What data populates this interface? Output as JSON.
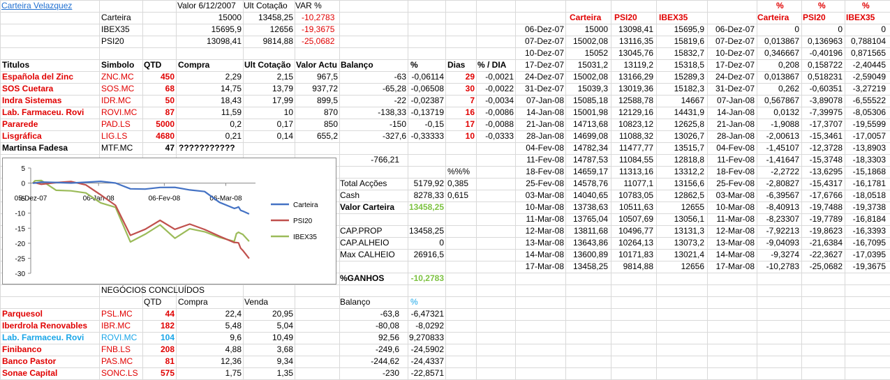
{
  "left": {
    "title": "Carteira Velazquez",
    "hdr": {
      "valor": "Valor 6/12/2007",
      "ult": "Ult Cotação",
      "var": "VAR %"
    },
    "summary": [
      {
        "name": "Carteira",
        "valor": "15000",
        "ult": "13458,25",
        "var": "-10,2783"
      },
      {
        "name": "IBEX35",
        "valor": "15695,9",
        "ult": "12656",
        "var": "-19,3675"
      },
      {
        "name": "PSI20",
        "valor": "13098,41",
        "ult": "9814,88",
        "var": "-25,0682"
      }
    ],
    "cols": {
      "titulos": "Titulos",
      "simbolo": "Simbolo",
      "qtd": "QTD",
      "compra": "Compra",
      "ult": "Ult Cotação",
      "valor": "Valor Actu",
      "balanco": "Balanço",
      "pct": "%",
      "dias": "Dias",
      "pdia": "% / DIA"
    },
    "holdings": [
      {
        "name": "Española del Zinc",
        "sym": "ZNC.MC",
        "qtd": "450",
        "compra": "2,29",
        "ult": "2,15",
        "valor": "967,5",
        "bal": "-63",
        "pct": "-0,06114",
        "dias": "29",
        "pdia": "-0,0021"
      },
      {
        "name": "SOS Cuetara",
        "sym": "SOS.MC",
        "qtd": "68",
        "compra": "14,75",
        "ult": "13,79",
        "valor": "937,72",
        "bal": "-65,28",
        "pct": "-0,06508",
        "dias": "30",
        "pdia": "-0,0022"
      },
      {
        "name": "Indra Sistemas",
        "sym": "IDR.MC",
        "qtd": "50",
        "compra": "18,43",
        "ult": "17,99",
        "valor": "899,5",
        "bal": "-22",
        "pct": "-0,02387",
        "dias": "7",
        "pdia": "-0,0034"
      },
      {
        "name": "Lab. Farmaceu. Rovi",
        "sym": "ROVI.MC",
        "qtd": "87",
        "compra": "11,59",
        "ult": "10",
        "valor": "870",
        "bal": "-138,33",
        "pct": "-0,13719",
        "dias": "16",
        "pdia": "-0,0086"
      },
      {
        "name": "Pararede",
        "sym": "PAD.LS",
        "qtd": "5000",
        "compra": "0,2",
        "ult": "0,17",
        "valor": "850",
        "bal": "-150",
        "pct": "-0,15",
        "dias": "17",
        "pdia": "-0,0088"
      },
      {
        "name": "Lisgráfica",
        "sym": "LIG.LS",
        "qtd": "4680",
        "compra": "0,21",
        "ult": "0,14",
        "valor": "655,2",
        "bal": "-327,6",
        "pct": "-0,33333",
        "dias": "10",
        "pdia": "-0,0333"
      }
    ],
    "martinsa": {
      "name": "Martinsa Fadesa",
      "sym": "MTF.MC",
      "qtd": "47",
      "compra": "???????????"
    },
    "total_bal": "-766,21",
    "pct_hdr": "%%%",
    "totals": [
      {
        "label": "Total Acções",
        "val": "5179,92",
        "pct": "0,385"
      },
      {
        "label": "Cash",
        "val": "8278,33",
        "pct": "0,615"
      }
    ],
    "valor_carteira": {
      "label": "Valor Carteira",
      "val": "13458,25"
    },
    "caps": [
      {
        "label": "CAP.PROP",
        "val": "13458,25"
      },
      {
        "label": "CAP.ALHEIO",
        "val": "0"
      },
      {
        "label": "Max CALHEIO",
        "val": "26916,5"
      }
    ],
    "ganhos": {
      "label": "%GANHOS",
      "val": "-10,2783"
    },
    "closed": {
      "title": "NEGÓCIOS CONCLUÍDOS",
      "hdr": {
        "qtd": "QTD",
        "compra": "Compra",
        "venda": "Venda",
        "bal": "Balanço",
        "pct": "%"
      },
      "rows": [
        {
          "name": "Parquesol",
          "sym": "PSL.MC",
          "qtd": "44",
          "compra": "22,4",
          "venda": "20,95",
          "bal": "-63,8",
          "pct": "-6,47321",
          "color": "red"
        },
        {
          "name": "Iberdrola Renovables",
          "sym": "IBR.MC",
          "qtd": "182",
          "compra": "5,48",
          "venda": "5,04",
          "bal": "-80,08",
          "pct": "-8,0292",
          "color": "red"
        },
        {
          "name": "Lab. Farmaceu. Rovi",
          "sym": "ROVI.MC",
          "qtd": "104",
          "compra": "9,6",
          "venda": "10,49",
          "bal": "92,56",
          "pct": "9,270833",
          "color": "blu"
        },
        {
          "name": "Finibanco",
          "sym": "FNB.LS",
          "qtd": "208",
          "compra": "4,88",
          "venda": "3,68",
          "bal": "-249,6",
          "pct": "-24,5902",
          "color": "red"
        },
        {
          "name": "Banco Pastor",
          "sym": "PAS.MC",
          "qtd": "81",
          "compra": "12,36",
          "venda": "9,34",
          "bal": "-244,62",
          "pct": "-24,4337",
          "color": "red"
        },
        {
          "name": "Sonae Capital",
          "sym": "SONC.LS",
          "qtd": "575",
          "compra": "1,75",
          "venda": "1,35",
          "bal": "-230",
          "pct": "-22,8571",
          "color": "red"
        }
      ]
    }
  },
  "right": {
    "hdr": {
      "carteira": "Carteira",
      "psi": "PSI20",
      "ibex": "IBEX35",
      "pct": "%"
    },
    "rows": [
      [
        "06-Dez-07",
        "15000",
        "13098,41",
        "15695,9",
        "06-Dez-07",
        "0",
        "0",
        "0"
      ],
      [
        "07-Dez-07",
        "15002,08",
        "13116,35",
        "15819,6",
        "07-Dez-07",
        "0,013867",
        "0,136963",
        "0,788104"
      ],
      [
        "10-Dez-07",
        "15052",
        "13045,76",
        "15832,7",
        "10-Dez-07",
        "0,346667",
        "-0,40196",
        "0,871565"
      ],
      [
        "17-Dez-07",
        "15031,2",
        "13119,2",
        "15318,5",
        "17-Dez-07",
        "0,208",
        "0,158722",
        "-2,40445"
      ],
      [
        "24-Dez-07",
        "15002,08",
        "13166,29",
        "15289,3",
        "24-Dez-07",
        "0,013867",
        "0,518231",
        "-2,59049"
      ],
      [
        "31-Dez-07",
        "15039,3",
        "13019,36",
        "15182,3",
        "31-Dez-07",
        "0,262",
        "-0,60351",
        "-3,27219"
      ],
      [
        "07-Jan-08",
        "15085,18",
        "12588,78",
        "14667",
        "07-Jan-08",
        "0,567867",
        "-3,89078",
        "-6,55522"
      ],
      [
        "14-Jan-08",
        "15001,98",
        "12129,16",
        "14431,9",
        "14-Jan-08",
        "0,0132",
        "-7,39975",
        "-8,05306"
      ],
      [
        "21-Jan-08",
        "14713,68",
        "10823,12",
        "12625,8",
        "21-Jan-08",
        "-1,9088",
        "-17,3707",
        "-19,5599"
      ],
      [
        "28-Jan-08",
        "14699,08",
        "11088,32",
        "13026,7",
        "28-Jan-08",
        "-2,00613",
        "-15,3461",
        "-17,0057"
      ],
      [
        "04-Fev-08",
        "14782,34",
        "11477,77",
        "13515,7",
        "04-Fev-08",
        "-1,45107",
        "-12,3728",
        "-13,8903"
      ],
      [
        "11-Fev-08",
        "14787,53",
        "11084,55",
        "12818,8",
        "11-Fev-08",
        "-1,41647",
        "-15,3748",
        "-18,3303"
      ],
      [
        "18-Fev-08",
        "14659,17",
        "11313,16",
        "13312,2",
        "18-Fev-08",
        "-2,2722",
        "-13,6295",
        "-15,1868"
      ],
      [
        "25-Fev-08",
        "14578,76",
        "11077,1",
        "13156,6",
        "25-Fev-08",
        "-2,80827",
        "-15,4317",
        "-16,1781"
      ],
      [
        "03-Mar-08",
        "14040,65",
        "10783,05",
        "12862,5",
        "03-Mar-08",
        "-6,39567",
        "-17,6766",
        "-18,0518"
      ],
      [
        "10-Mar-08",
        "13738,63",
        "10511,63",
        "12655",
        "10-Mar-08",
        "-8,40913",
        "-19,7488",
        "-19,3738"
      ],
      [
        "11-Mar-08",
        "13765,04",
        "10507,69",
        "13056,1",
        "11-Mar-08",
        "-8,23307",
        "-19,7789",
        "-16,8184"
      ],
      [
        "12-Mar-08",
        "13811,68",
        "10496,77",
        "13131,3",
        "12-Mar-08",
        "-7,92213",
        "-19,8623",
        "-16,3393"
      ],
      [
        "13-Mar-08",
        "13643,86",
        "10264,13",
        "13073,2",
        "13-Mar-08",
        "-9,04093",
        "-21,6384",
        "-16,7095"
      ],
      [
        "14-Mar-08",
        "13600,89",
        "10171,83",
        "13021,4",
        "14-Mar-08",
        "-9,3274",
        "-22,3627",
        "-17,0395"
      ],
      [
        "17-Mar-08",
        "13458,25",
        "9814,88",
        "12656",
        "17-Mar-08",
        "-10,2783",
        "-25,0682",
        "-19,3675"
      ]
    ]
  },
  "chart_data": {
    "type": "line",
    "x": [
      "06-Dez-07",
      "07-Dez-07",
      "10-Dez-07",
      "17-Dez-07",
      "24-Dez-07",
      "31-Dez-07",
      "07-Jan-08",
      "14-Jan-08",
      "21-Jan-08",
      "28-Jan-08",
      "04-Fev-08",
      "11-Fev-08",
      "18-Fev-08",
      "25-Fev-08",
      "03-Mar-08",
      "10-Mar-08",
      "11-Mar-08",
      "12-Mar-08",
      "13-Mar-08",
      "14-Mar-08",
      "17-Mar-08"
    ],
    "tick_labels": [
      "05-Dez-07",
      "06-Jan-08",
      "06-Fev-08",
      "06-Mar-08"
    ],
    "ylim": [
      -30,
      5
    ],
    "yticks": [
      5,
      0,
      -5,
      -10,
      -15,
      -20,
      -25,
      -30
    ],
    "legend": "right",
    "series": [
      {
        "name": "Carteira",
        "color": "#4472c4",
        "values": [
          0,
          0.013867,
          0.346667,
          0.208,
          0.013867,
          0.262,
          0.567867,
          0.0132,
          -1.9088,
          -2.00613,
          -1.45107,
          -1.41647,
          -2.2722,
          -2.80827,
          -6.39567,
          -8.40913,
          -8.23307,
          -7.92213,
          -9.04093,
          -9.3274,
          -10.2783
        ]
      },
      {
        "name": "PSI20",
        "color": "#c0504d",
        "values": [
          0,
          0.136963,
          -0.40196,
          0.158722,
          0.518231,
          -0.60351,
          -3.89078,
          -7.39975,
          -17.3707,
          -15.3461,
          -12.3728,
          -15.3748,
          -13.6295,
          -15.4317,
          -17.6766,
          -19.7488,
          -19.7789,
          -19.8623,
          -21.6384,
          -22.3627,
          -25.0682
        ]
      },
      {
        "name": "IBEX35",
        "color": "#9bbb59",
        "values": [
          0,
          0.788104,
          0.871565,
          -2.40445,
          -2.59049,
          -3.27219,
          -6.55522,
          -8.05306,
          -19.5599,
          -17.0057,
          -13.8903,
          -18.3303,
          -15.1868,
          -16.1781,
          -18.0518,
          -19.3738,
          -16.8184,
          -16.3393,
          -16.7095,
          -17.0395,
          -19.3675
        ]
      }
    ]
  }
}
